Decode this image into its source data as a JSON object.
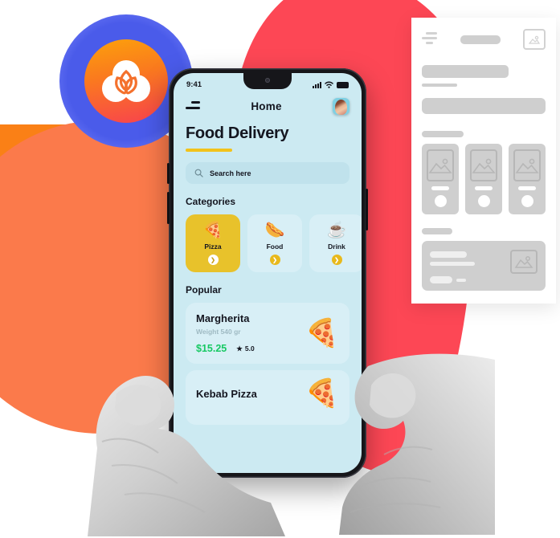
{
  "brand": {
    "logo_icon": "venn-circles-logo",
    "ring_color": "#4A5BEA",
    "core_gradient_from": "#FCA10B",
    "core_gradient_to": "#F8424E"
  },
  "background": {
    "orange_block_color": "#FA8016",
    "orange_circle_color": "#FB7A4B",
    "red_blob_color": "#FD4755"
  },
  "phone": {
    "screen_bg": "#CCEAF2",
    "status_bar": {
      "time": "9:41",
      "signal_icon": "signal-bars-icon",
      "wifi_icon": "wifi-icon",
      "battery_icon": "battery-full-icon"
    },
    "nav": {
      "menu_icon": "hamburger-menu-icon",
      "title": "Home",
      "avatar_icon": "user-avatar"
    },
    "heading": "Food Delivery",
    "search": {
      "icon": "search-icon",
      "placeholder": "Search here"
    },
    "categories_title": "Categories",
    "categories": [
      {
        "label": "Pizza",
        "emoji": "🍕",
        "icon": "pizza-slice-icon",
        "active": true,
        "go_icon": "chevron-right-icon"
      },
      {
        "label": "Food",
        "emoji": "🌭",
        "icon": "hotdog-icon",
        "active": false,
        "go_icon": "chevron-right-icon"
      },
      {
        "label": "Drink",
        "emoji": "☕",
        "icon": "coffee-cup-icon",
        "active": false,
        "go_icon": "chevron-right-icon"
      }
    ],
    "popular_title": "Popular",
    "popular": [
      {
        "name": "Margherita",
        "weight": "Weight 540 gr",
        "price": "$15.25",
        "rating": "5.0",
        "star_icon": "star-icon",
        "emoji": "🍕"
      },
      {
        "name": "Kebab Pizza",
        "emoji": "🍕"
      }
    ],
    "accent_underline_color": "#F2C21B",
    "price_color": "#18C964",
    "active_category_color": "#E8C22B"
  },
  "wireframe": {
    "menu_icon": "wireframe-menu-icon",
    "title_placeholder": "wireframe-title-bar",
    "thumb_icon": "image-placeholder-icon",
    "tiles": [
      {
        "image_icon": "image-placeholder-icon"
      },
      {
        "image_icon": "image-placeholder-icon"
      },
      {
        "image_icon": "image-placeholder-icon"
      }
    ],
    "wide_card_image_icon": "image-placeholder-icon",
    "block_color": "#cfcfcf",
    "card_bg": "#ffffff"
  },
  "hands": {
    "left_hand": "left-hand-holding-phone",
    "right_hand": "right-hand-holding-phone",
    "style": "grayscale"
  }
}
